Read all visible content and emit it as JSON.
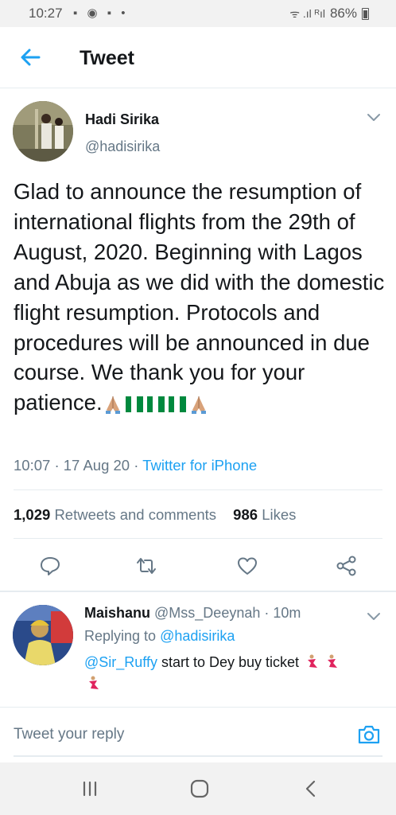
{
  "status_bar": {
    "time": "10:27",
    "notifications": "▪ ◉ ▪ •",
    "signal": "ᯤ .ıl ᴿıl",
    "battery": "86%"
  },
  "header": {
    "back_icon": "arrow-left-icon",
    "title": "Tweet"
  },
  "tweet": {
    "author_name": "Hadi Sirika",
    "author_handle": "@hadisirika",
    "text": "Glad to announce the resumption of international flights from the 29th of August, 2020. Beginning with Lagos and Abuja as we did with the domestic flight resumption. Protocols and procedures will be announced in due course. We thank you for your patience.",
    "emojis": [
      "folded-hands",
      "flag-nigeria",
      "flag-nigeria",
      "flag-nigeria",
      "folded-hands"
    ],
    "time": "10:07",
    "date": "17 Aug 20",
    "separator": "·",
    "source": "Twitter for iPhone",
    "retweets_count": "1,029",
    "retweets_label": "Retweets and comments",
    "likes_count": "986",
    "likes_label": "Likes"
  },
  "actions": [
    "reply-icon",
    "retweet-icon",
    "like-icon",
    "share-icon"
  ],
  "reply": {
    "name": "Maishanu",
    "handle": "@Mss_Deeynah",
    "time": "· 10m",
    "replying_label": "Replying to",
    "replying_to": "@hadisirika",
    "mention": "@Sir_Ruffy",
    "text": " start to Dey buy ticket"
  },
  "compose": {
    "placeholder": "Tweet your reply",
    "camera_icon": "camera-icon"
  },
  "nav": [
    "recent-apps-icon",
    "home-icon",
    "back-icon"
  ],
  "colors": {
    "accent": "#1da1f2",
    "secondary_text": "#657786",
    "divider": "#e6ecf0"
  }
}
